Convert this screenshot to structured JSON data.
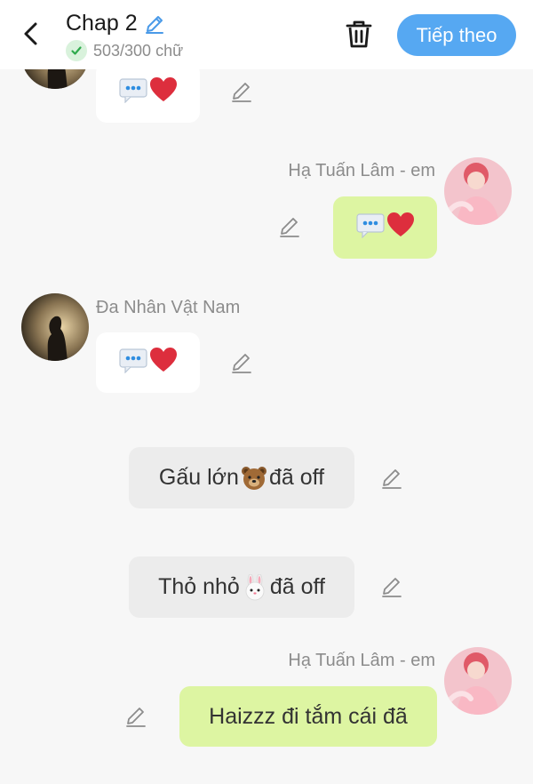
{
  "header": {
    "title": "Chap 2",
    "word_count": "503/300 chữ",
    "next_label": "Tiếp theo"
  },
  "messages": [
    {
      "id": "m1",
      "type": "received",
      "name": "",
      "content": "typing-heart"
    },
    {
      "id": "m2",
      "type": "sent",
      "name": "Hạ Tuấn Lâm - em",
      "content": "typing-heart"
    },
    {
      "id": "m3",
      "type": "received",
      "name": "Đa Nhân Vật Nam",
      "content": "typing-heart"
    },
    {
      "id": "m4",
      "type": "system",
      "text_before": "Gấu lớn",
      "emoji": "bear-face",
      "text_after": "đã off"
    },
    {
      "id": "m5",
      "type": "system",
      "text_before": "Thỏ nhỏ",
      "emoji": "rabbit-face",
      "text_after": "đã off"
    },
    {
      "id": "m6",
      "type": "sent",
      "name": "Hạ Tuấn Lâm - em",
      "content": "Haizzz đi tắm cái đã"
    }
  ],
  "colors": {
    "accent": "#56a8f2",
    "sent_bubble": "#ddf5a2",
    "received_bubble": "#ffffff",
    "system_bubble": "#ececec",
    "background": "#f7f7f7"
  }
}
